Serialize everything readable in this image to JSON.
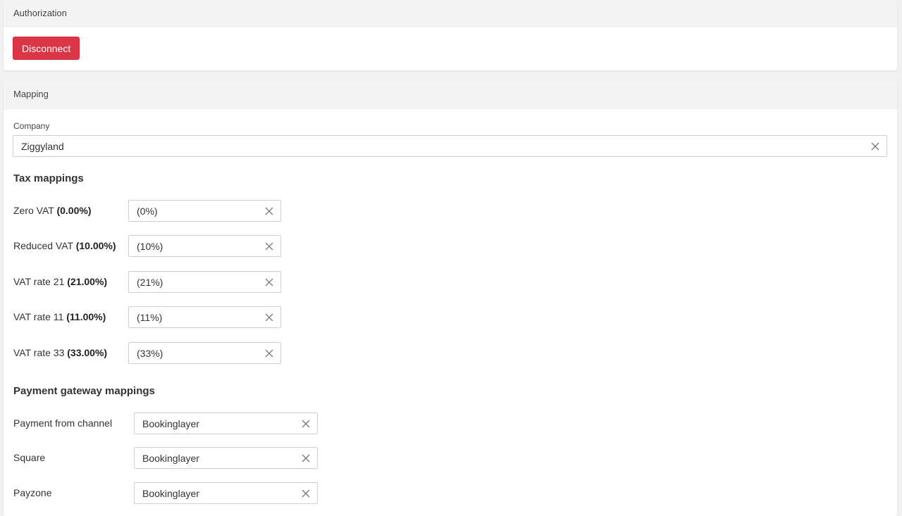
{
  "authorization": {
    "header": "Authorization",
    "disconnect_label": "Disconnect"
  },
  "mapping": {
    "header": "Mapping",
    "company_label": "Company",
    "company_value": "Ziggyland",
    "tax_title": "Tax mappings",
    "tax_rows": [
      {
        "name": "Zero VAT",
        "rate": "(0.00%)",
        "value": "(0%)"
      },
      {
        "name": "Reduced VAT",
        "rate": "(10.00%)",
        "value": "(10%)"
      },
      {
        "name": "VAT rate 21",
        "rate": "(21.00%)",
        "value": "(21%)"
      },
      {
        "name": "VAT rate 11",
        "rate": "(11.00%)",
        "value": "(11%)"
      },
      {
        "name": "VAT rate 33",
        "rate": "(33.00%)",
        "value": "(33%)"
      }
    ],
    "payment_title": "Payment gateway mappings",
    "payment_rows": [
      {
        "name": "Payment from channel",
        "value": "Bookinglayer"
      },
      {
        "name": "Square",
        "value": "Bookinglayer"
      },
      {
        "name": "Payzone",
        "value": "Bookinglayer"
      }
    ]
  },
  "colors": {
    "danger": "#dc3545",
    "header_bg": "#f4f4f4"
  },
  "icons": {
    "clear": "close-icon"
  }
}
